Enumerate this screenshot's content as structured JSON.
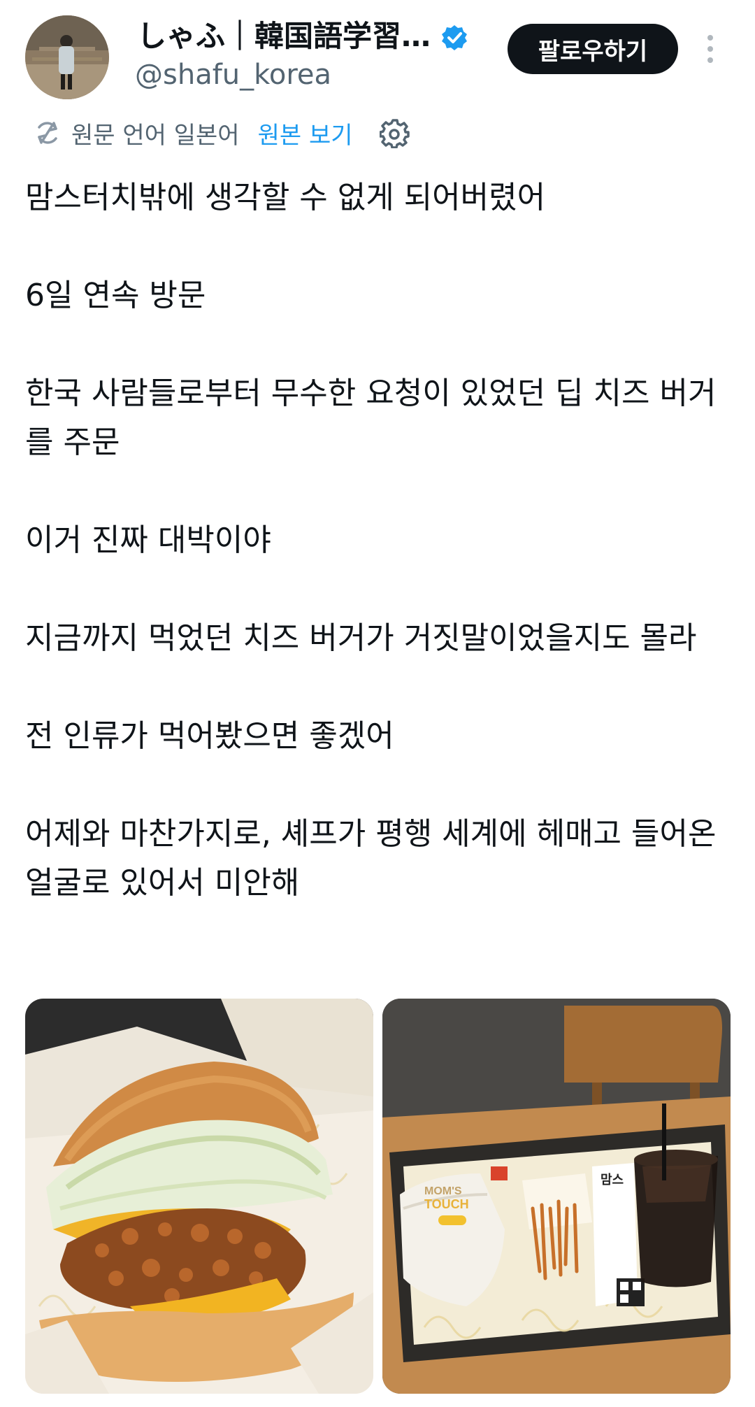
{
  "author": {
    "display_name": "しゃふ｜韓国語学習…",
    "handle": "@shafu_korea",
    "verified": true
  },
  "follow_button": {
    "label": "팔로우하기"
  },
  "translation": {
    "status": "원문 언어 일본어",
    "show_original": "원본 보기"
  },
  "post": {
    "paragraphs": [
      "맘스터치밖에 생각할 수 없게 되어버렸어",
      "6일 연속 방문",
      "한국 사람들로부터 무수한 요청이 있었던 딥 치즈 버거를 주문",
      "이거 진짜 대박이야",
      "지금까지 먹었던 치즈 버거가 거짓말이었을지도 몰라",
      "전 인류가 먹어봤으면 좋겠어",
      "어제와 마찬가지로, 셰프가 평행 세계에 헤매고 들어온 얼굴로 있어서 미안해"
    ]
  },
  "photos": {
    "left_text": {
      "tray_brand": ""
    },
    "right_text": {
      "wrapper_brand_1": "MOM'S",
      "wrapper_brand_2": "TOUCH",
      "tray_sign": "맘스"
    }
  },
  "colors": {
    "accent": "#1d9bf0",
    "text_primary": "#0f1419",
    "text_secondary": "#536471",
    "button_bg": "#0f1419"
  },
  "icons": {
    "verified": "verified-badge-icon",
    "more": "more-options-icon",
    "translate": "translate-icon",
    "settings": "gear-icon"
  }
}
